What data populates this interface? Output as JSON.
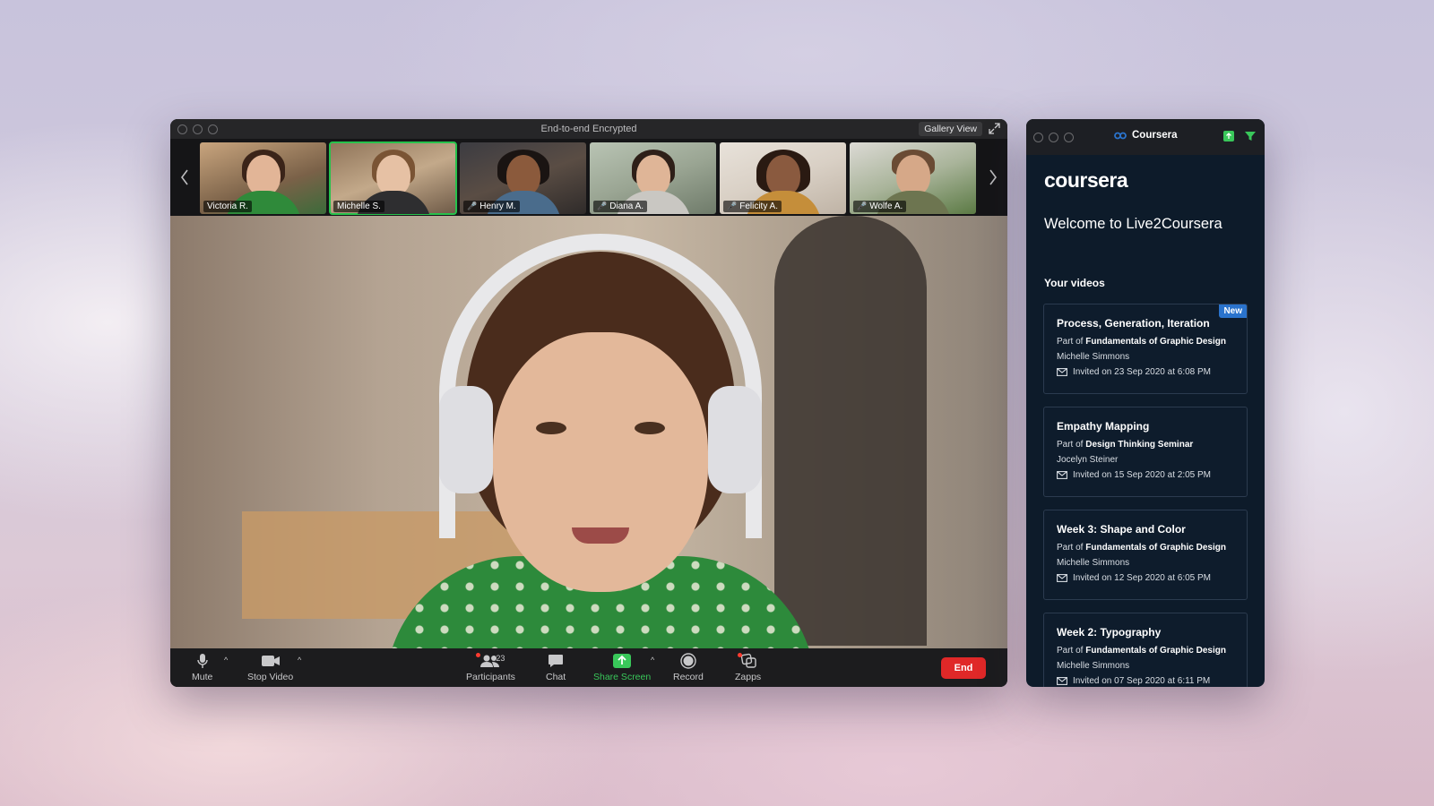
{
  "zoom": {
    "title": "End-to-end Encrypted",
    "gallery_view": "Gallery View",
    "participants": [
      {
        "name": "Victoria R.",
        "muted": false,
        "active": false
      },
      {
        "name": "Michelle S.",
        "muted": false,
        "active": true
      },
      {
        "name": "Henry M.",
        "muted": true,
        "active": false
      },
      {
        "name": "Diana A.",
        "muted": true,
        "active": false
      },
      {
        "name": "Felicity A.",
        "muted": true,
        "active": false
      },
      {
        "name": "Wolfe A.",
        "muted": true,
        "active": false
      }
    ],
    "toolbar": {
      "mute": "Mute",
      "stop_video": "Stop Video",
      "participants": "Participants",
      "participants_count": "23",
      "chat": "Chat",
      "share_screen": "Share Screen",
      "record": "Record",
      "zapps": "Zapps",
      "end": "End"
    },
    "colors": {
      "active_border": "#27c24c",
      "share": "#39c75a",
      "end": "#e02828"
    }
  },
  "coursera": {
    "window_title": "Coursera",
    "logo": "coursera",
    "welcome": "Welcome to Live2Coursera",
    "section_title": "Your videos",
    "videos": [
      {
        "title": "Process, Generation, Iteration",
        "part_prefix": "Part of",
        "course": "Fundamentals of Graphic Design",
        "author": "Michelle Simmons",
        "invited": "Invited on 23 Sep 2020 at 6:08 PM",
        "badge": "New"
      },
      {
        "title": "Empathy Mapping",
        "part_prefix": "Part of",
        "course": "Design Thinking Seminar",
        "author": "Jocelyn Steiner",
        "invited": "Invited on 15 Sep 2020 at 2:05 PM"
      },
      {
        "title": "Week 3: Shape and Color",
        "part_prefix": "Part of",
        "course": "Fundamentals of Graphic Design",
        "author": "Michelle Simmons",
        "invited": "Invited on 12 Sep 2020 at 6:05 PM"
      },
      {
        "title": "Week 2: Typography",
        "part_prefix": "Part of",
        "course": "Fundamentals of Graphic Design",
        "author": "Michelle Simmons",
        "invited": "Invited on 07 Sep 2020 at 6:11 PM"
      }
    ],
    "colors": {
      "background": "#0d1b2a",
      "badge": "#2a73cc",
      "brand": "#2a73cc"
    }
  }
}
